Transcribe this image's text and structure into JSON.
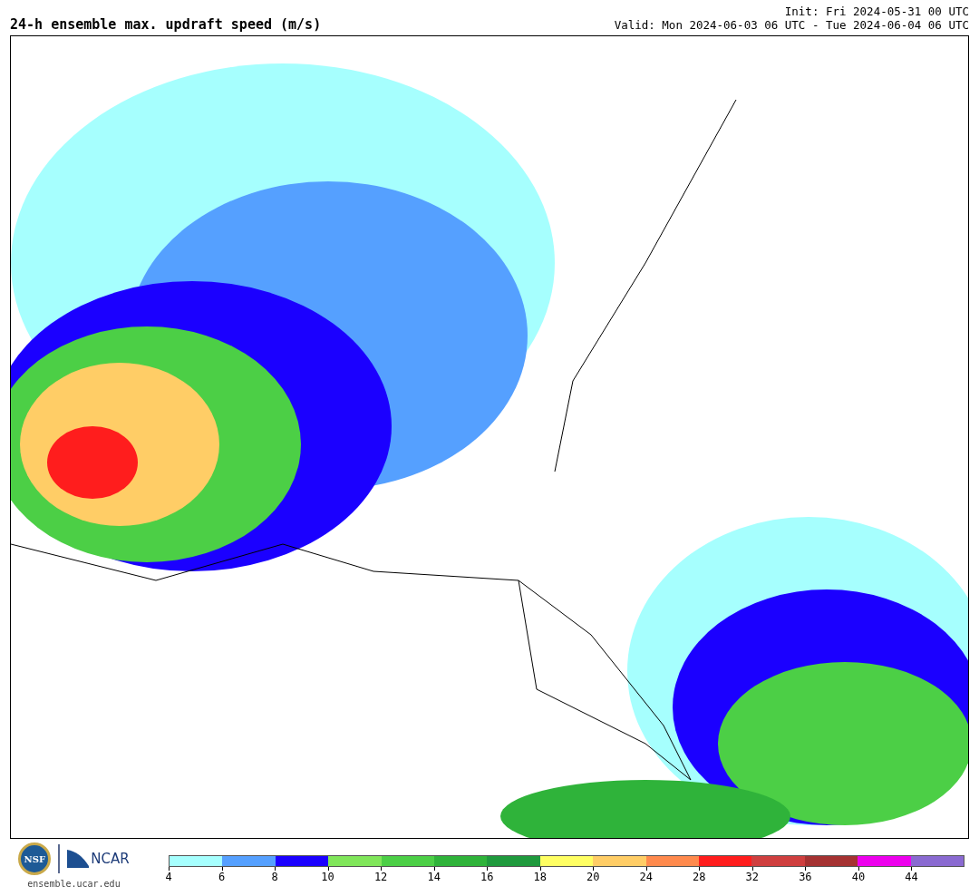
{
  "title": "24-h ensemble max. updraft speed (m/s)",
  "init": "Init: Fri 2024-05-31 00 UTC",
  "valid": "Valid: Mon 2024-06-03 06 UTC - Tue 2024-06-04 06 UTC",
  "logos": {
    "nsf": "NSF",
    "ncar": "NCAR",
    "site": "ensemble.ucar.edu"
  },
  "colorbar": [
    {
      "color": "#a6fffe",
      "label": "4"
    },
    {
      "color": "#55a0ff",
      "label": "6"
    },
    {
      "color": "#1b00ff",
      "label": "8"
    },
    {
      "color": "#80e65a",
      "label": "10"
    },
    {
      "color": "#4ccf46",
      "label": "12"
    },
    {
      "color": "#2fb33a",
      "label": "14"
    },
    {
      "color": "#1f9a3d",
      "label": "16"
    },
    {
      "color": "#ffff63",
      "label": "18"
    },
    {
      "color": "#ffcd66",
      "label": "20"
    },
    {
      "color": "#ff8a4d",
      "label": "24"
    },
    {
      "color": "#ff1d1d",
      "label": "28"
    },
    {
      "color": "#cf3f3f",
      "label": "32"
    },
    {
      "color": "#a53232",
      "label": "36"
    },
    {
      "color": "#ed00ed",
      "label": "40"
    },
    {
      "color": "#8a6ad1",
      "label": "44"
    }
  ]
}
